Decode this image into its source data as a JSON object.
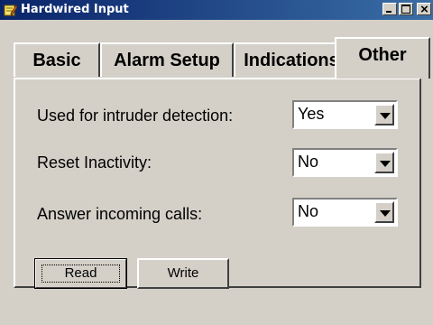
{
  "window": {
    "title": "Hardwired Input",
    "title_icon": "pencil-notepad-icon"
  },
  "tabs": [
    {
      "label": "Basic"
    },
    {
      "label": "Alarm Setup"
    },
    {
      "label": "Indications"
    },
    {
      "label": "Other",
      "active": true
    }
  ],
  "settings": [
    {
      "label": "Used for intruder detection:",
      "value": "Yes"
    },
    {
      "label": "Reset Inactivity:",
      "value": "No"
    },
    {
      "label": "Answer incoming calls:",
      "value": "No"
    }
  ],
  "buttons": {
    "read": "Read",
    "write": "Write"
  }
}
